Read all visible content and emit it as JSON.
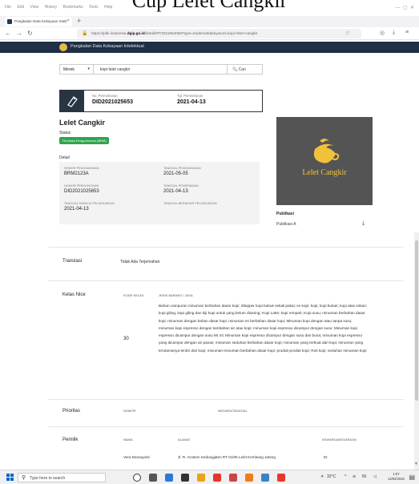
{
  "top_banner": "Cup Lelet Cangkir",
  "browser": {
    "menu": [
      "File",
      "Edit",
      "View",
      "History",
      "Bookmarks",
      "Tools",
      "Help"
    ],
    "tab_title": "Pangkalan Data Kekayaan Intelr",
    "url_prefix": "https://pdki-indonesia.",
    "url_domain": "dgip.go.id",
    "url_rest": "/detail/IPT2021054059?type=trademark&keyword=kopi+lelet+cangkir"
  },
  "site": {
    "title": "Pangkalan Data Kekayaan Intelektual"
  },
  "search": {
    "type_label": "Merek",
    "query": "kopi lelet cangkir",
    "button_label": "Cari"
  },
  "application": {
    "no_label": "No. Permohonan",
    "no_value": "DID2021025653",
    "date_label": "Tgl. Permohonan",
    "date_value": "2021-04-13"
  },
  "brand": {
    "name": "Lelet Cangkir",
    "status_label": "Status",
    "status_value": "TM-Masa Pengumuman (BRM)",
    "detail_label": "Detail",
    "details": [
      {
        "label": "NOMOR PENGUMUMAN",
        "value": "BRM2123A"
      },
      {
        "label": "TANGGAL PENGUMUMAN",
        "value": "2021-05-05"
      },
      {
        "label": "NOMOR PERMOHONAN",
        "value": "DID2021025653"
      },
      {
        "label": "TANGGAL PENERIMAAN",
        "value": "2021-04-13"
      },
      {
        "label": "TANGGAL DIMULAI PELINDUNGAN",
        "value": "2021-04-13"
      },
      {
        "label": "TANGGAL BERAKHIR PELINDUNGAN",
        "value": ""
      }
    ],
    "image_text": "Lelet Cangkir",
    "publikasi_label": "Publikasi",
    "publikasi_item": "Publikasi A"
  },
  "translasi": {
    "label": "Translasi",
    "value": "Tidak Ada Terjemahan"
  },
  "kelas": {
    "label": "Kelas Nice",
    "col_code": "KODE KELAS",
    "col_desc": "JENIS BARANG / JASA",
    "code": "30",
    "description": "Bahan campuran minuman berbahan dasar kopi; ditepper kopi bubuk sekali pakai; es kopi; kopi; kopi bubuk; kopi atas eskan; kopi giling; kopi giling dan biji kopi untuk yang belum disaring; Kopi Latte; kopi rempah; Kopi susu; minuman berbahan dasar kopi; minuman dengan bahan dasar kopi; minuman es berbahan dasar kopi; Minuman kopi dengan atau tanpa susu; minuman kopi espresso dengan tambahan air atau kopi; minuman kopi espresso dicampur dengan susu; Minuman kopi espresso dicampur dengan susu 90 ml; Minuman kopi espresso dicampur dengan susu dan busa; minuman kopi espresso yang dicampur dengan air panas; minuman seduhan berbahan dasar kopi; minuman yang terbuat dari kopi; minuman yang terutamanya terdiri dari kopi; minuman-minuman berbahan dasar kopi; produk-produk kopi; Roti kopi; seduhan minuman kopi"
  },
  "prioritas": {
    "label": "Prioritas",
    "col_nomor": "NOMOR",
    "col_negara": "NEGARA/TANGGAL"
  },
  "pemilik": {
    "label": "Pemilik",
    "col_nama": "NAMA",
    "col_alamat": "ALAMAT",
    "col_kewarganegaraan": "KEWARGANEGARAAN",
    "row_nama": "Vera Damayanti",
    "row_alamat": "Jl. R. Aroteen Kedungjaten RT 01/05 Lelet Kembang Jateng",
    "row_kw": "ID"
  },
  "taskbar": {
    "search_placeholder": "Type here to search",
    "weather": "32°C",
    "time": "1:07",
    "date": "12/04/2022"
  },
  "colors": {
    "header": "#1e2f46",
    "badge": "#2ea44f",
    "brand_gold": "#f0c23a"
  }
}
